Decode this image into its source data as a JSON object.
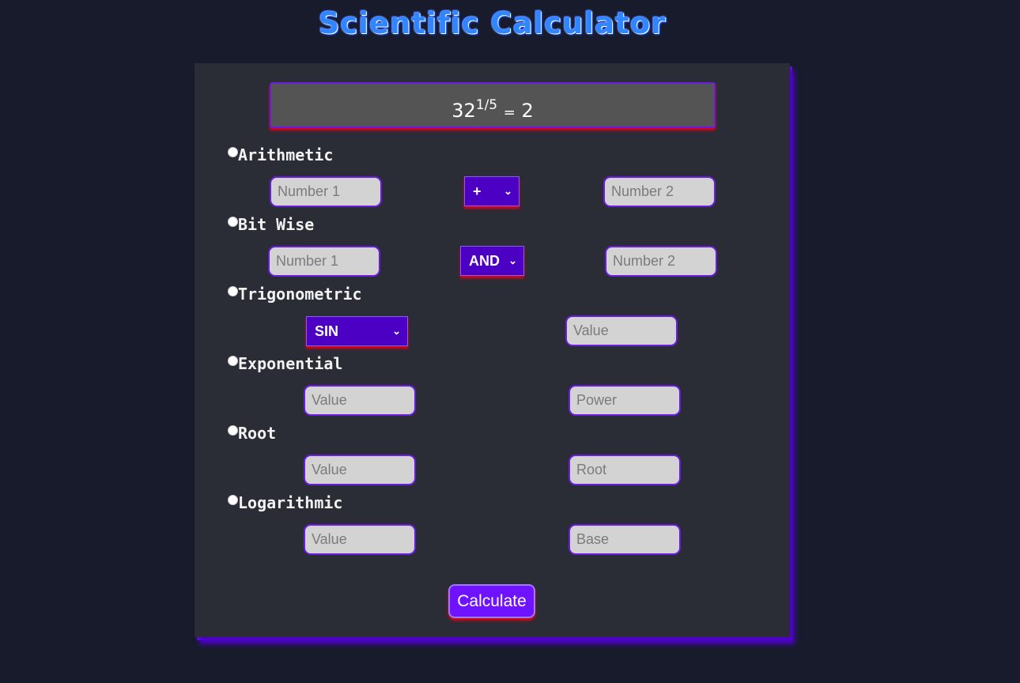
{
  "title": "Scientific Calculator",
  "display": {
    "base": "32",
    "exponent": "1/5",
    "equals": "=",
    "result": "2"
  },
  "arithmetic": {
    "label": "Arithmetic",
    "num1_placeholder": "Number 1",
    "operator": "+",
    "num2_placeholder": "Number 2"
  },
  "bitwise": {
    "label": "Bit Wise",
    "num1_placeholder": "Number 1",
    "operator": "AND",
    "num2_placeholder": "Number 2"
  },
  "trigonometric": {
    "label": "Trigonometric",
    "function": "SIN",
    "value_placeholder": "Value"
  },
  "exponential": {
    "label": "Exponential",
    "value_placeholder": "Value",
    "power_placeholder": "Power"
  },
  "root": {
    "label": "Root",
    "value_placeholder": "Value",
    "root_placeholder": "Root"
  },
  "logarithmic": {
    "label": "Logarithmic",
    "value_placeholder": "Value",
    "base_placeholder": "Base"
  },
  "calculate_label": "Calculate",
  "colors": {
    "accent": "#6e12ff",
    "title": "#2f86ff",
    "background": "#171b2b",
    "card": "#2a2c36"
  }
}
